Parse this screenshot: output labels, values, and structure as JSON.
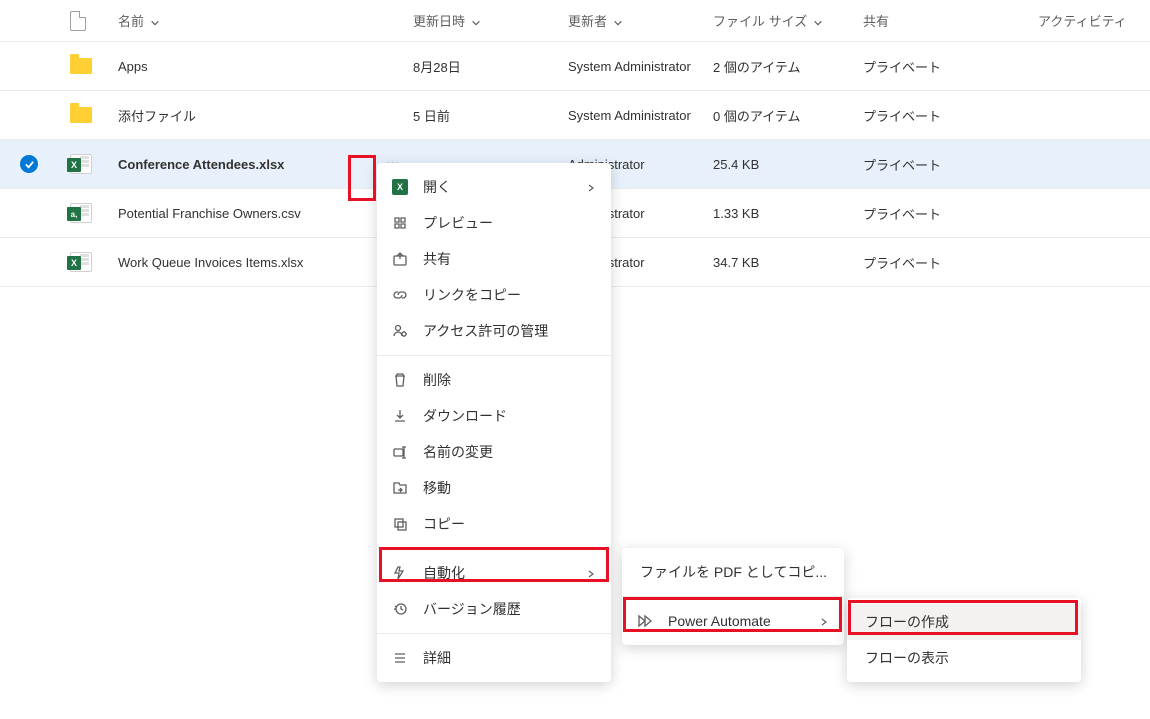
{
  "columns": {
    "name": "名前",
    "modified": "更新日時",
    "modifiedBy": "更新者",
    "size": "ファイル サイズ",
    "sharing": "共有",
    "activity": "アクティビティ"
  },
  "rows": [
    {
      "icon": "folder",
      "name": "Apps",
      "modified": "8月28日",
      "modifiedBy": "System Administrator",
      "size": "2 個のアイテム",
      "sharing": "プライベート",
      "selected": false
    },
    {
      "icon": "folder",
      "name": "添付ファイル",
      "modified": "5 日前",
      "modifiedBy": "System Administrator",
      "size": "0 個のアイテム",
      "sharing": "プライベート",
      "selected": false
    },
    {
      "icon": "excel",
      "name": "Conference Attendees.xlsx",
      "modified": "",
      "modifiedBy": "Administrator",
      "size": "25.4 KB",
      "sharing": "プライベート",
      "selected": true
    },
    {
      "icon": "csv",
      "name": "Potential Franchise Owners.csv",
      "modified": "",
      "modifiedBy": "Administrator",
      "size": "1.33 KB",
      "sharing": "プライベート",
      "selected": false
    },
    {
      "icon": "excel",
      "name": "Work Queue Invoices Items.xlsx",
      "modified": "",
      "modifiedBy": "Administrator",
      "size": "34.7 KB",
      "sharing": "プライベート",
      "selected": false
    }
  ],
  "menu1": {
    "open": "開く",
    "preview": "プレビュー",
    "share": "共有",
    "copyLink": "リンクをコピー",
    "managePerm": "アクセス許可の管理",
    "delete": "削除",
    "download": "ダウンロード",
    "rename": "名前の変更",
    "move": "移動",
    "copy": "コピー",
    "automate": "自動化",
    "versionHistory": "バージョン履歴",
    "details": "詳細"
  },
  "menu2": {
    "pdfCopy": "ファイルを PDF としてコピ...",
    "powerAutomate": "Power Automate"
  },
  "menu3": {
    "createFlow": "フローの作成",
    "viewFlows": "フローの表示"
  },
  "highlights": {
    "moreButton": true,
    "automate": true,
    "powerAutomate": true,
    "createFlow": true
  }
}
